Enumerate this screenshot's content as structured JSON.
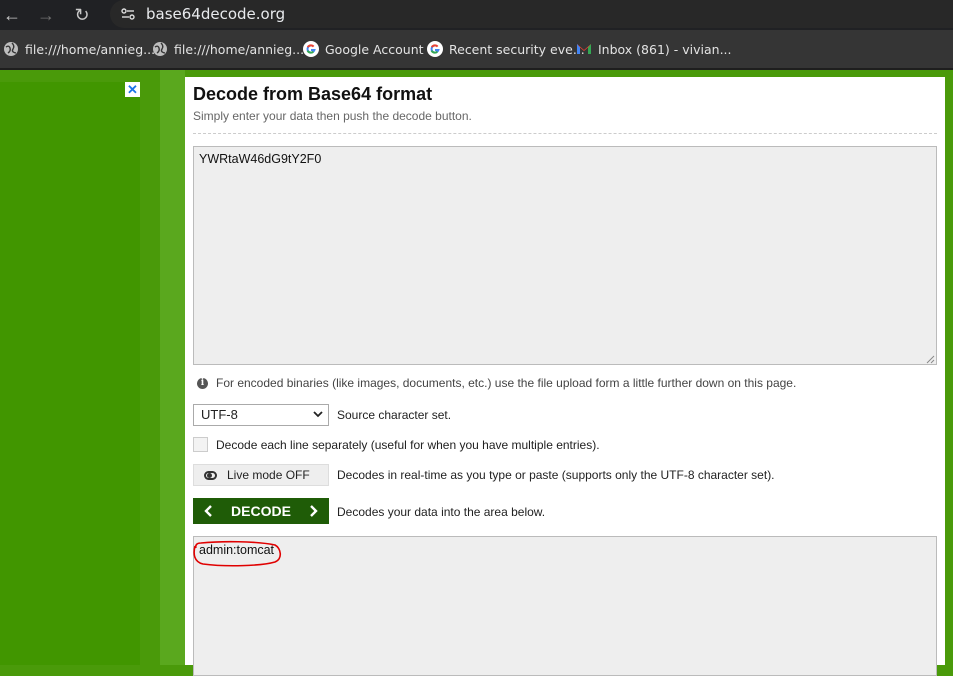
{
  "browser": {
    "url": "base64decode.org",
    "bookmarks": [
      {
        "label": "file:///home/annieg...",
        "icon": "globe-icon"
      },
      {
        "label": "file:///home/annieg...",
        "icon": "globe-icon"
      },
      {
        "label": "Google Account",
        "icon": "google-icon"
      },
      {
        "label": "Recent security eve...",
        "icon": "google-icon"
      },
      {
        "label": "Inbox (861) - vivian...",
        "icon": "gmail-icon"
      }
    ]
  },
  "ad": {
    "close_label": "✕"
  },
  "page": {
    "title": "Decode from Base64 format",
    "subtitle": "Simply enter your data then push the decode button.",
    "input_value": "YWRtaW46dG9tY2F0",
    "note": "For encoded binaries (like images, documents, etc.) use the file upload form a little further down on this page.",
    "charset": {
      "selected": "UTF-8",
      "label": "Source character set."
    },
    "checkbox_label": "Decode each line separately (useful for when you have multiple entries).",
    "livemode": {
      "label": "Live mode OFF",
      "description": "Decodes in real-time as you type or paste (supports only the UTF-8 character set)."
    },
    "decode": {
      "label": "DECODE",
      "description": "Decodes your data into the area below."
    },
    "output_value": "admin:tomcat"
  },
  "colors": {
    "page_green": "#4a9a0a",
    "button_green": "#1f5c07",
    "annotation_red": "#e00000"
  }
}
